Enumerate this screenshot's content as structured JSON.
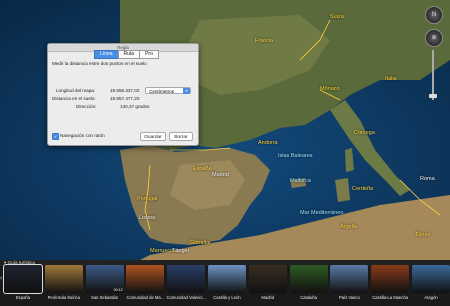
{
  "map_labels": {
    "francia": "Francia",
    "espana": "España",
    "portugal": "Portugal",
    "madrid": "Madrid",
    "suiza": "Suiza",
    "monaco": "Mónaco",
    "lisboa": "Lisboa",
    "tanger": "Tánger",
    "argelia": "Argelia",
    "marruecos": "Marruecos",
    "gibraltar": "Gibraltar",
    "mar_med": "Mar Mediterráneo",
    "andorra": "Andorra",
    "mallorca": "Mallorca",
    "tuskas": "Túnez",
    "italia": "Italia",
    "sardinia": "Cerdeña",
    "corsica": "Córcega",
    "islas": "Islas Baleares",
    "roma": "Roma"
  },
  "dialog": {
    "title": "Regla",
    "tabs": [
      "Línea",
      "Ruta",
      "Pro"
    ],
    "active_tab": "Línea",
    "instruction": "Medir la distancia entre dos puntos en el suelo",
    "map_length_label": "Longitud del mapa:",
    "map_length_value": "19.656.337,02",
    "ground_length_label": "Distancia en el suelo:",
    "ground_length_value": "19.857.477,20",
    "direction_label": "Dirección:",
    "direction_value": "130,37 grados",
    "unit": "Centímetros",
    "nav_checkbox_label": "Navegación con ratón",
    "nav_checked": true,
    "save_button": "Guardar",
    "clear_button": "Borrar"
  },
  "tour": {
    "header": "Guía turística",
    "items": [
      {
        "label": "España",
        "color": "#1e2430"
      },
      {
        "label": "Península Ibérica",
        "color": "#a17a3a"
      },
      {
        "label": "San Sebastián",
        "color": "#3d5a86"
      },
      {
        "label": "Comunidad de Ma...",
        "color": "#b05420"
      },
      {
        "label": "Comunidad Valenci...",
        "color": "#2a3e67"
      },
      {
        "label": "Castilla y León",
        "color": "#6d94c4"
      },
      {
        "label": "Madrid",
        "color": "#3a2e22"
      },
      {
        "label": "Cataluña",
        "color": "#2f5b23"
      },
      {
        "label": "País Vasco",
        "color": "#5a7aa8"
      },
      {
        "label": "Castilla-La Mancha",
        "color": "#8a3a1a"
      },
      {
        "label": "Aragón",
        "color": "#3a6a9a"
      }
    ],
    "thumb_time": "00:12"
  },
  "colors": {
    "accent": "#4a8ee5",
    "border_yellow": "#ffd23c"
  }
}
